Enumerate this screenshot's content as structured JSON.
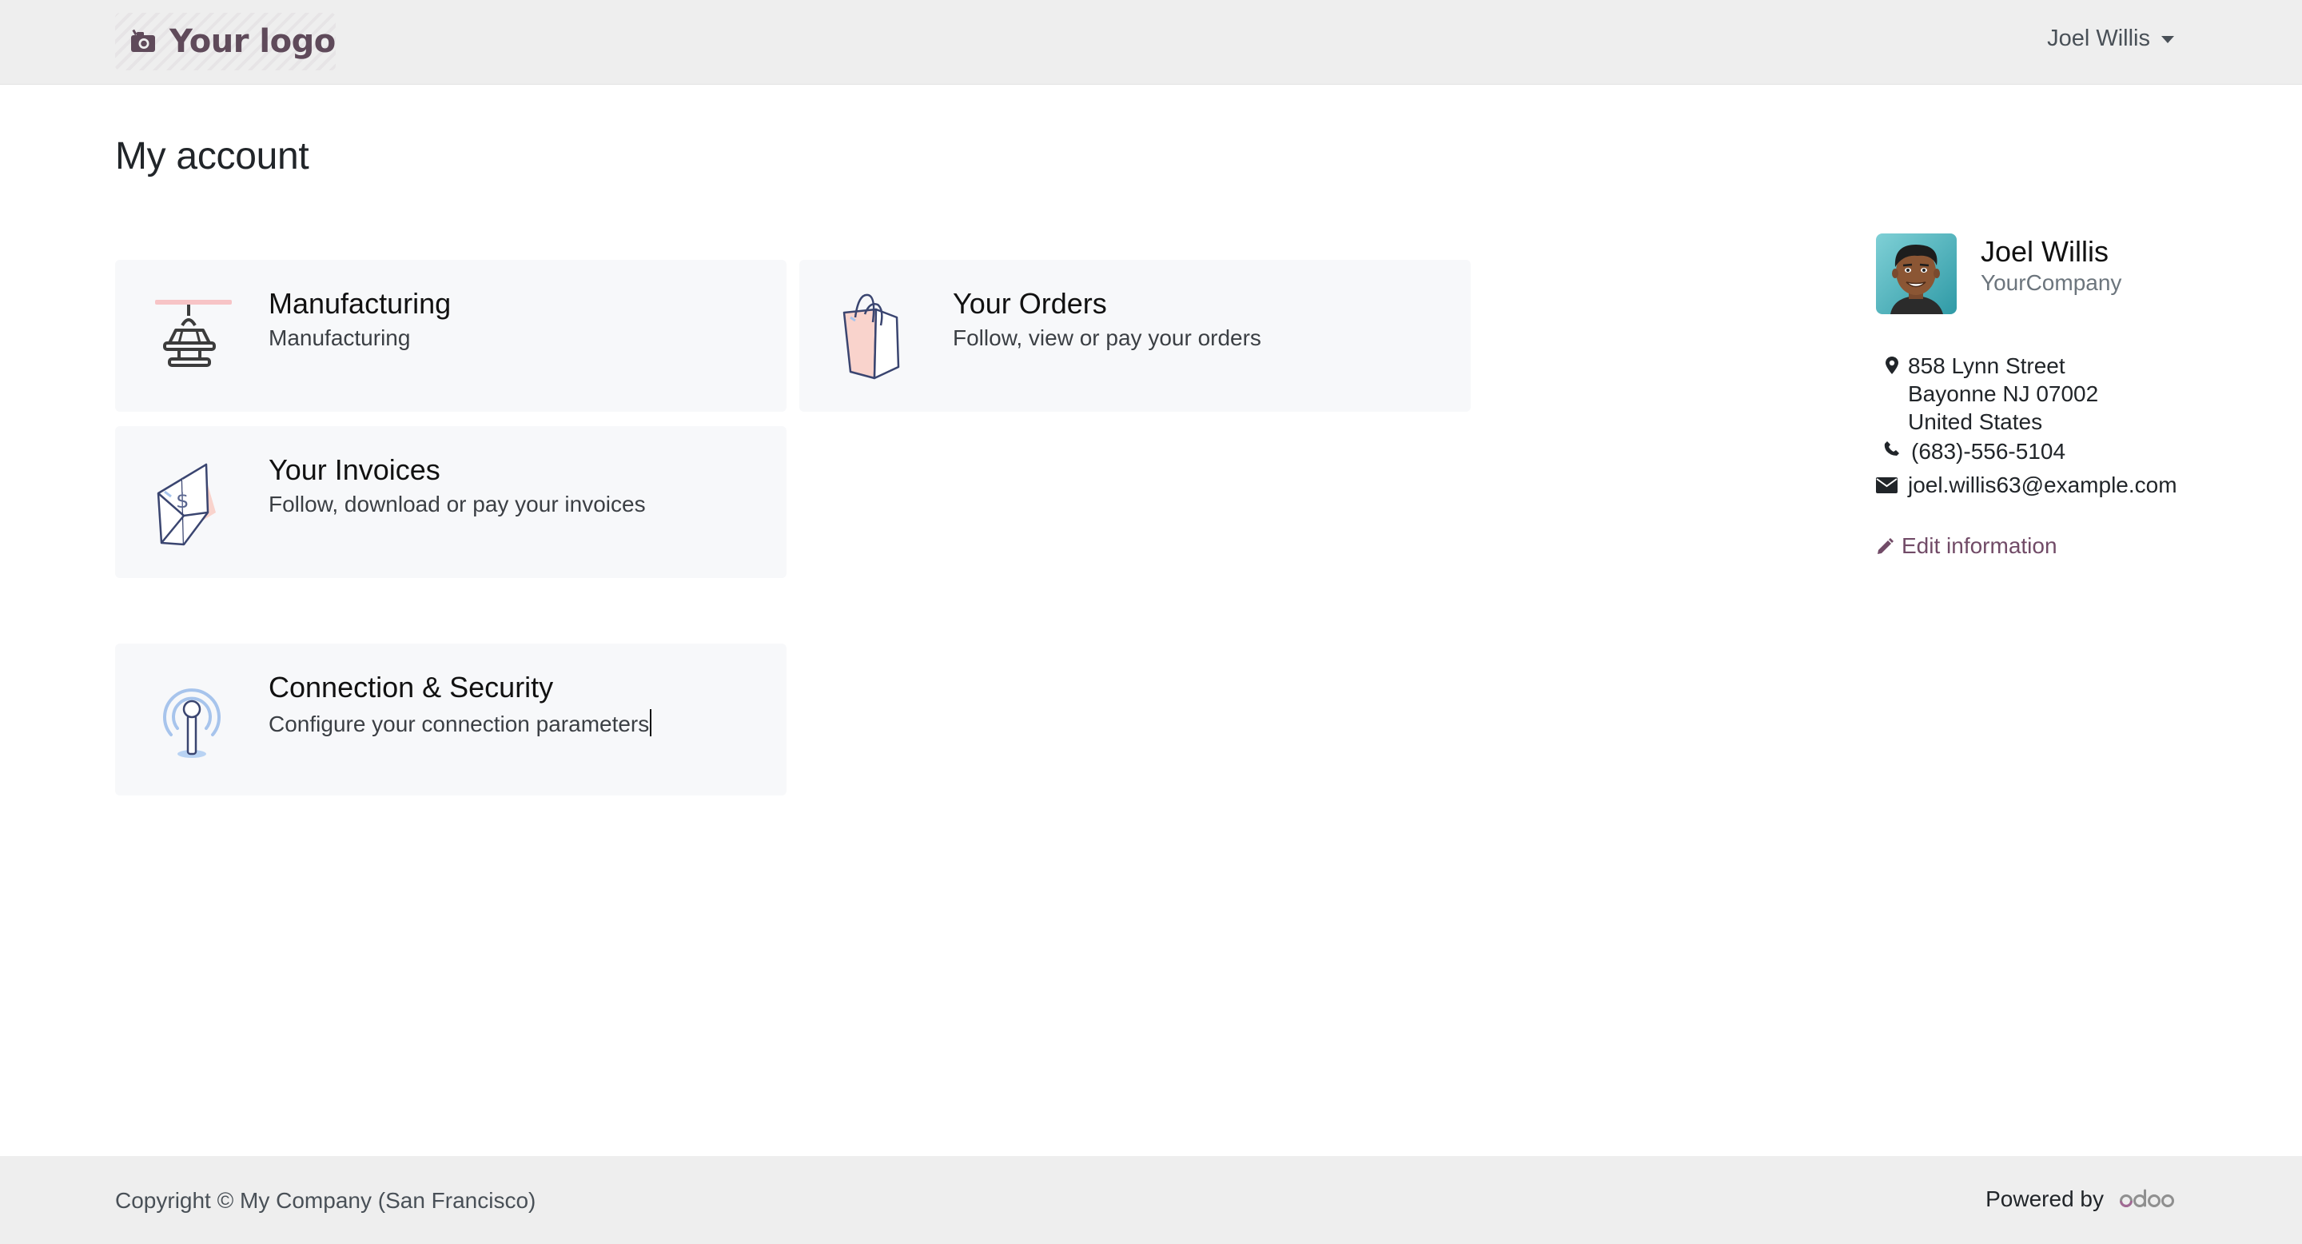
{
  "header": {
    "logo_text": "Your logo",
    "user_name": "Joel Willis"
  },
  "main": {
    "title": "My account",
    "cards": [
      {
        "title": "Manufacturing",
        "description": "Manufacturing",
        "icon": "manufacturing-icon"
      },
      {
        "title": "Your Orders",
        "description": "Follow, view or pay your orders",
        "icon": "shopping-bag-icon"
      },
      {
        "title": "Your Invoices",
        "description": "Follow, download or pay your invoices",
        "icon": "invoice-envelope-icon"
      },
      {
        "title": "Connection & Security",
        "description": "Configure your connection parameters",
        "icon": "antenna-icon"
      }
    ]
  },
  "profile": {
    "name": "Joel Willis",
    "company": "YourCompany",
    "address": [
      "858 Lynn Street",
      "Bayonne NJ 07002",
      "United States"
    ],
    "phone": "(683)-556-5104",
    "email": "joel.willis63@example.com",
    "edit_label": "Edit information"
  },
  "footer": {
    "copyright": "Copyright © My Company (San Francisco)",
    "powered_by": "Powered by",
    "brand": "odoo"
  },
  "colors": {
    "accent": "#714b67",
    "header_bg": "#eeeeee",
    "card_bg": "#f7f8fa"
  }
}
